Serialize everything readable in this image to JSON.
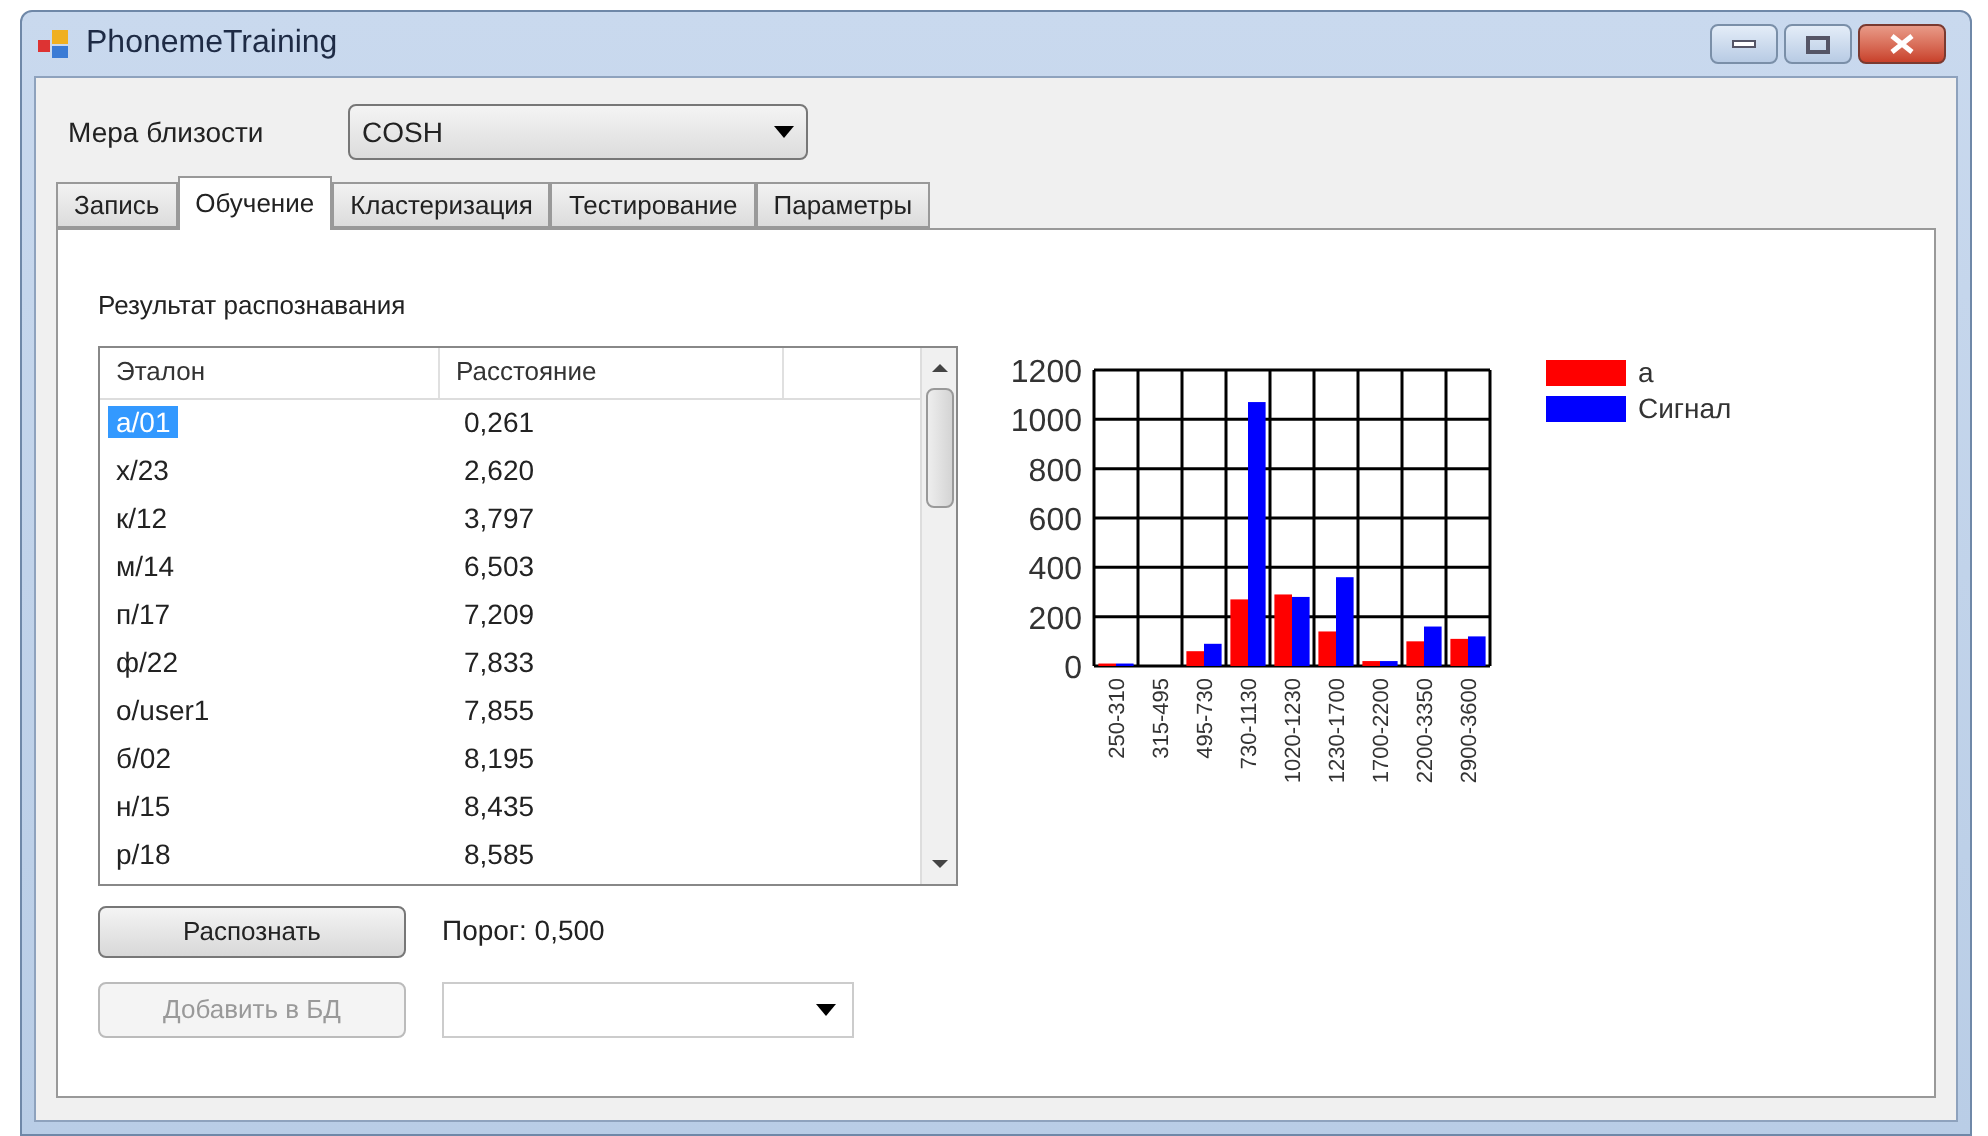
{
  "window": {
    "title": "PhonemeTraining"
  },
  "measure": {
    "label": "Мера близости",
    "value": "COSH"
  },
  "tabs": [
    {
      "label": "Запись",
      "selected": false
    },
    {
      "label": "Обучение",
      "selected": true
    },
    {
      "label": "Кластеризация",
      "selected": false
    },
    {
      "label": "Тестирование",
      "selected": false
    },
    {
      "label": "Параметры",
      "selected": false
    }
  ],
  "result_label": "Результат распознавания",
  "table": {
    "columns": [
      "Эталон",
      "Расстояние"
    ],
    "rows": [
      {
        "cells": [
          "а/01",
          "0,261"
        ],
        "selected": true
      },
      {
        "cells": [
          "х/23",
          "2,620"
        ],
        "selected": false
      },
      {
        "cells": [
          "к/12",
          "3,797"
        ],
        "selected": false
      },
      {
        "cells": [
          "м/14",
          "6,503"
        ],
        "selected": false
      },
      {
        "cells": [
          "п/17",
          "7,209"
        ],
        "selected": false
      },
      {
        "cells": [
          "ф/22",
          "7,833"
        ],
        "selected": false
      },
      {
        "cells": [
          "о/user1",
          "7,855"
        ],
        "selected": false
      },
      {
        "cells": [
          "б/02",
          "8,195"
        ],
        "selected": false
      },
      {
        "cells": [
          "н/15",
          "8,435"
        ],
        "selected": false
      },
      {
        "cells": [
          "р/18",
          "8,585"
        ],
        "selected": false
      }
    ]
  },
  "chart_data": {
    "type": "bar",
    "categories": [
      "250-310",
      "315-495",
      "495-730",
      "730-1130",
      "1020-1230",
      "1230-1700",
      "1700-2200",
      "2200-3350",
      "2900-3600"
    ],
    "series": [
      {
        "name": "а",
        "color": "#ff0000",
        "values": [
          10,
          0,
          60,
          270,
          290,
          140,
          20,
          100,
          110
        ]
      },
      {
        "name": "Сигнал",
        "color": "#0000ff",
        "values": [
          10,
          0,
          90,
          1070,
          280,
          360,
          20,
          160,
          120
        ]
      }
    ],
    "ylim": [
      0,
      1200
    ],
    "yticks": [
      0,
      200,
      400,
      600,
      800,
      1000,
      1200
    ],
    "grid": true,
    "legend": true
  },
  "recognize_button": {
    "label": "Распознать",
    "disabled": false
  },
  "threshold": "Порог: 0,500",
  "add_button": {
    "label": "Добавить в БД",
    "disabled": true
  }
}
